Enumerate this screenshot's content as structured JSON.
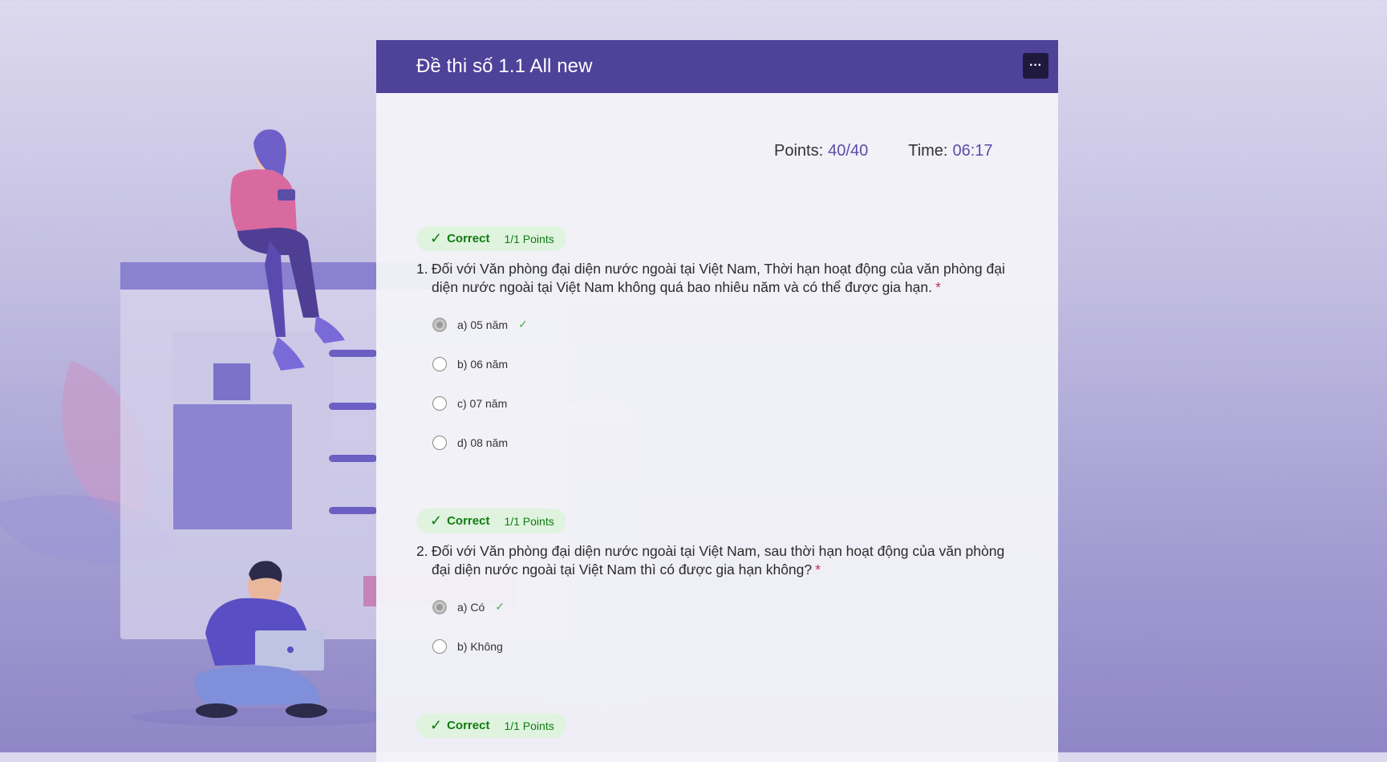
{
  "form": {
    "title": "Đề thi số 1.1 All new",
    "more_label": "···",
    "points_label": "Points:",
    "points_value": "40/40",
    "time_label": "Time:",
    "time_value": "06:17"
  },
  "questions": [
    {
      "badge_status": "Correct",
      "badge_points": "1/1 Points",
      "number": "1.",
      "text": "Đối với Văn phòng đại diện nước ngoài tại Việt Nam, Thời hạn hoạt động của văn phòng đại diện nước ngoài tại Việt Nam không quá bao nhiêu năm và có thể được gia hạn.",
      "required_mark": "*",
      "options": [
        "a) 05 năm",
        "b) 06 năm",
        "c) 07 năm",
        "d) 08 năm"
      ],
      "selected_index": 0
    },
    {
      "badge_status": "Correct",
      "badge_points": "1/1 Points",
      "number": "2.",
      "text": "Đối với Văn phòng đại diện nước ngoài tại Việt Nam, sau thời hạn hoạt động của văn phòng đại diện nước ngoài tại Việt Nam thì có được gia hạn không?",
      "required_mark": "*",
      "options": [
        "a) Có",
        "b) Không"
      ],
      "selected_index": 0
    },
    {
      "badge_status": "Correct",
      "badge_points": "1/1 Points"
    }
  ],
  "icons": {
    "badge": "checkmark-icon",
    "correct_answer": "checkmark-icon",
    "more": "more-options-icon"
  },
  "colors": {
    "header": "#4e4299",
    "correct": "#107c10",
    "badge_bg": "#dff3df",
    "required": "#c4314b",
    "accent": "#5a4ea7"
  }
}
